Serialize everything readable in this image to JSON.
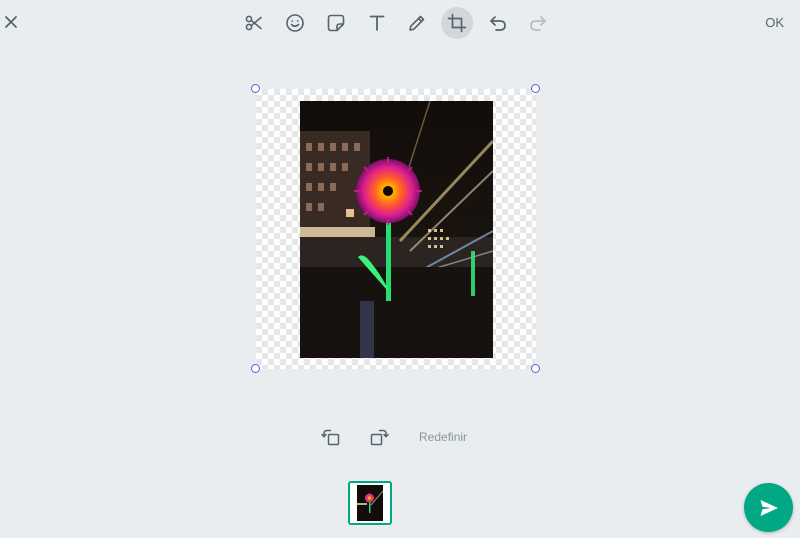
{
  "toolbar": {
    "ok_label": "OK",
    "active_tool": "crop-rotate",
    "tools": [
      "scissors-icon",
      "emoji-icon",
      "sticker-icon",
      "text-icon",
      "pencil-icon",
      "crop-icon",
      "undo-icon",
      "redo-icon"
    ]
  },
  "controls": {
    "reset_label": "Redefinir"
  },
  "colors": {
    "background": "#e9edef",
    "accent": "#00a884",
    "icon": "#54656f",
    "muted": "#8696a0",
    "active_tool_bg": "#d1d7db",
    "crop_handle": "#5b5fd6"
  }
}
